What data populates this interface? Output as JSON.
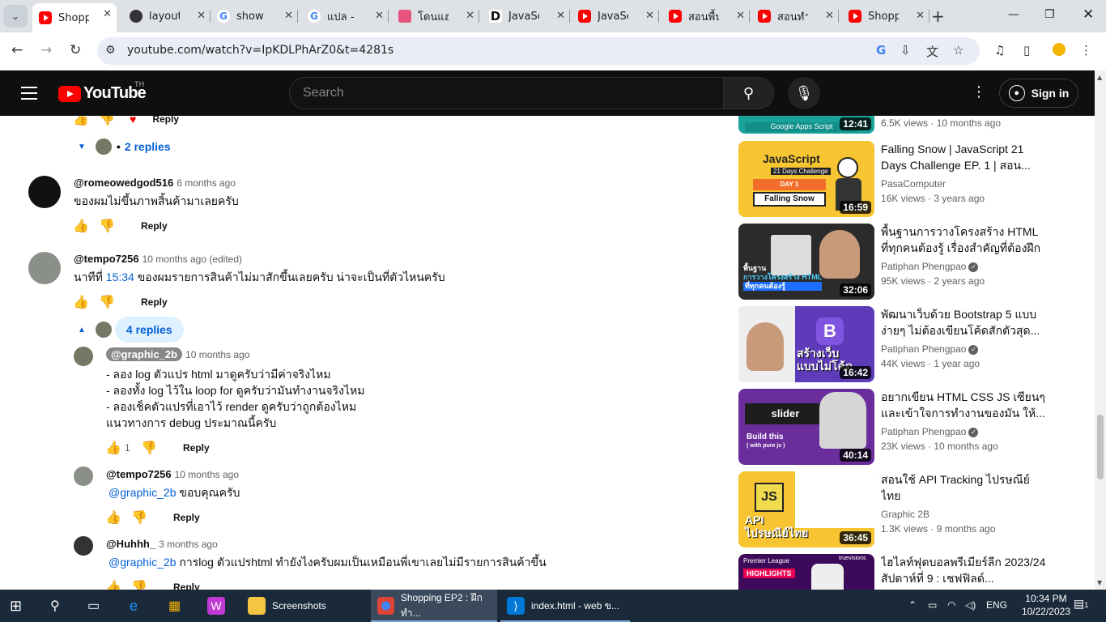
{
  "browser": {
    "tabs": [
      {
        "title": "Shoppi",
        "icon": "youtube-favicon",
        "active": true
      },
      {
        "title": "layout",
        "icon": "github-favicon"
      },
      {
        "title": "show c",
        "icon": "google-favicon"
      },
      {
        "title": "แปล - ตั",
        "icon": "google-favicon"
      },
      {
        "title": "โดนแฮง",
        "icon": "pink-favicon"
      },
      {
        "title": "JavaScr",
        "icon": "d-favicon"
      },
      {
        "title": "JavaScr",
        "icon": "youtube-favicon"
      },
      {
        "title": "สอนพื้นฐ",
        "icon": "youtube-favicon"
      },
      {
        "title": "สอนทำ l",
        "icon": "youtube-favicon"
      },
      {
        "title": "Shoppi",
        "icon": "youtube-favicon"
      }
    ],
    "url": "youtube.com/watch?v=IpKDLPhArZ0&t=4281s"
  },
  "youtube": {
    "country": "TH",
    "logo_text": "YouTube",
    "search_placeholder": "Search",
    "signin_label": "Sign in"
  },
  "comments": {
    "top_reply_label": "Reply",
    "top_replies_label": "2 replies",
    "c1": {
      "author": "@romeowedgod516",
      "time": "6 months ago",
      "text": "ของผมไม่ขึ้นภาพสิ้นค้ามาเลยครับ",
      "reply": "Reply"
    },
    "c2": {
      "author": "@tempo7256",
      "time": "10 months ago (edited)",
      "text_prefix": "นาทีที่ ",
      "link": "15:34",
      "text_suffix": " ของผมรายการสินค้าไม่มาสักขึ้นเลยครับ น่าจะเป็นที่ตัวไหนครับ",
      "reply": "Reply",
      "replies_label": "4 replies"
    },
    "r1": {
      "author": "@graphic_2b",
      "time": "10 months ago",
      "lines": [
        "- ลอง log ตัวแปร html มาดูครับว่ามีค่าจริงไหม",
        "- ลองทั้ง log ไว้ใน loop for ดูครับว่ามันทำงานจริงไหม",
        "- ลองเช็คตัวแปรที่เอาไว้ render ดูครับว่าถูกต้องไหม",
        "แนวทางการ debug ประมาณนี้ครับ"
      ],
      "likes": "1",
      "reply": "Reply"
    },
    "r2": {
      "author": "@tempo7256",
      "time": "10 months ago",
      "mention": "@graphic_2b",
      "text": " ขอบคุณครับ",
      "reply": "Reply"
    },
    "r3": {
      "author": "@Huhhh_",
      "time": "3 months ago",
      "mention": "@graphic_2b",
      "text": " การlog ตัวแปรhtml ทำยังไงครับผมเป็นเหมือนพี่เขาเลยไม่มีรายการสินค้าขึ้น",
      "reply": "Reply"
    }
  },
  "sidebar": {
    "top_meta": "6.5K views · 10 months ago",
    "top_duration": "12:41",
    "top_thumb_text": "Google Apps Script",
    "videos": [
      {
        "title": "Falling Snow | JavaScript 21 Days Challenge EP. 1 | สอน...",
        "channel": "PasaComputer",
        "verified": false,
        "meta": "16K views · 3 years ago",
        "duration": "16:59",
        "thumb": "yellow"
      },
      {
        "title": "พื้นฐานการวางโครงสร้าง HTML ที่ทุกคนต้องรู้ เรื่องสำคัญที่ต้องฝึกฝ...",
        "channel": "Patiphan Phengpao",
        "verified": true,
        "meta": "95K views · 2 years ago",
        "duration": "32:06",
        "thumb": "dark"
      },
      {
        "title": "พัฒนาเว็บด้วย Bootstrap 5 แบบง่ายๆ ไม่ต้องเขียนโค้ดสักตัวสุด...",
        "channel": "Patiphan Phengpao",
        "verified": true,
        "meta": "44K views · 1 year ago",
        "duration": "16:42",
        "thumb": "purple"
      },
      {
        "title": "อยากเขียน HTML CSS JS เซียนๆ และเข้าใจการทำงานของมัน ให้...",
        "channel": "Patiphan Phengpao",
        "verified": true,
        "meta": "23K views · 10 months ago",
        "duration": "40:14",
        "thumb": "violet"
      },
      {
        "title": "สอนใช้ API Tracking ไปรษณีย์ไทย",
        "channel": "Graphic 2B",
        "verified": false,
        "meta": "1.3K views · 9 months ago",
        "duration": "36:45",
        "thumb": "js"
      },
      {
        "title": "ไฮไลท์ฟุตบอลพรีเมียร์ลีก 2023/24 สัปดาห์ที่ 9 : เชฟฟิลด์...",
        "channel": "",
        "verified": false,
        "meta": "",
        "duration": "",
        "thumb": "pl"
      }
    ],
    "thumb_texts": {
      "yellow_top": "JavaScript",
      "yellow_mid": "21 Days Challenge",
      "yellow_day": "DAY 1",
      "yellow_bottom": "Falling Snow",
      "dark_line1": "พื้นฐาน",
      "dark_line2": "การวางโครงสร้าง HTML",
      "dark_line3": "ที่ทุกคนต้องรู้",
      "purple_letter": "B",
      "purple_line1": "สร้างเว็บ",
      "purple_line2": "แบบไม่โค้ด",
      "violet_word": "slider",
      "violet_build": "Build this",
      "violet_sub": "( with pure js )",
      "js_badge": "JS",
      "js_line1": "API",
      "js_line2": "ไปรษณีย์ไทย",
      "pl_brand": "Premier League",
      "pl_tag": "HIGHLIGHTS",
      "pl_tv": "truevisions"
    }
  },
  "taskbar": {
    "apps": [
      {
        "label": "Screenshots",
        "icon": "folder-icon"
      },
      {
        "label": "Shopping EP2 : ฝึกทำ...",
        "icon": "chrome-icon"
      },
      {
        "label": "index.html - web ข...",
        "icon": "vscode-icon"
      }
    ],
    "lang": "ENG",
    "time": "10:34 PM",
    "date": "10/22/2023",
    "notif_count": "1"
  }
}
